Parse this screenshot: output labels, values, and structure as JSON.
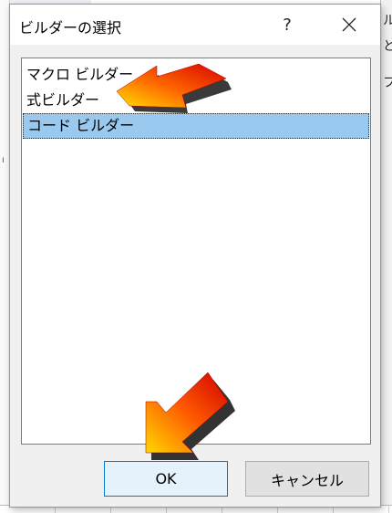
{
  "dialog": {
    "title": "ビルダーの選択",
    "help_label": "?",
    "close_icon": "close-icon"
  },
  "builders": [
    {
      "label": "マクロ ビルダー",
      "selected": false
    },
    {
      "label": "式ビルダー",
      "selected": false
    },
    {
      "label": "コード ビルダー",
      "selected": true
    }
  ],
  "buttons": {
    "ok_label": "OK",
    "cancel_label": "キャンセル"
  },
  "background": {
    "right_fragments": [
      "ル",
      "と印",
      "フッ"
    ],
    "left_mark": "ı"
  },
  "colors": {
    "selection": "#99c9ef",
    "ok_border": "#0078d7",
    "arrow_red": "#e60000",
    "arrow_yellow": "#ffd400"
  },
  "annotations": {
    "arrow_icon": "arrow-pointer-icon"
  }
}
